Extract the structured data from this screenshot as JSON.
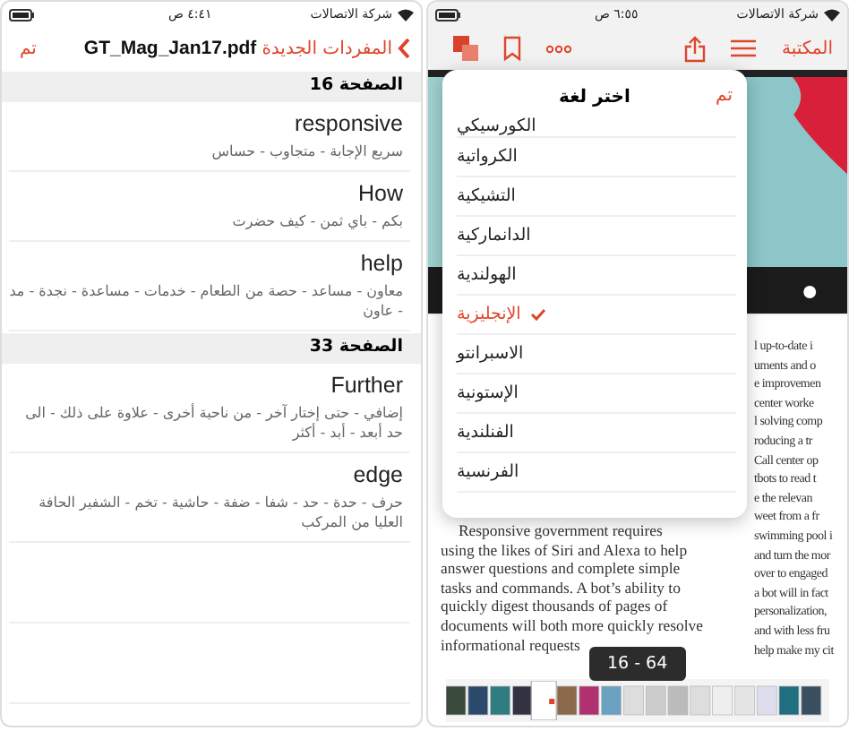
{
  "left_screen": {
    "status_bar": {
      "carrier": "شركة الاتصالات",
      "time": "٤:٤١ ص"
    },
    "nav_bar": {
      "back_label": "المفردات الجديدة",
      "title": "GT_Mag_Jan17.pdf",
      "done_label": "تم"
    },
    "sections": [
      {
        "header": "الصفحة 16",
        "entries": [
          {
            "word": "responsive",
            "translation": "سريع الإجابة - متجاوب - حساس"
          },
          {
            "word": "How",
            "translation": "بكم - باي ثمن - كيف حضرت"
          },
          {
            "word": "help",
            "translation": "معاون - مساعد - حصة من الطعام - خدمات - مساعدة - نجدة - مد - عاون"
          }
        ]
      },
      {
        "header": "الصفحة 33",
        "entries": [
          {
            "word": "Further",
            "translation": "إضافي - حتى إختار آخر - من ناحية أخرى - علاوة على ذلك - الى حد أبعد - أبد - أكثر"
          },
          {
            "word": "edge",
            "translation": "حرف - حدة - حد - شفا - ضفة - حاشية - تخم - الشفير الحافة العليا من المركب"
          }
        ]
      }
    ]
  },
  "right_screen": {
    "status_bar": {
      "carrier": "شركة الاتصالات",
      "time": "٦:٥٥ ص"
    },
    "toolbar": {
      "library_label": "المكتبة"
    },
    "language_picker": {
      "title": "اختر لغة",
      "done_label": "تم",
      "languages": [
        {
          "name": "الكورسيكي",
          "selected": false
        },
        {
          "name": "الكرواتية",
          "selected": false
        },
        {
          "name": "التشيكية",
          "selected": false
        },
        {
          "name": "الدانماركية",
          "selected": false
        },
        {
          "name": "الهولندية",
          "selected": false
        },
        {
          "name": "الإنجليزية",
          "selected": true
        },
        {
          "name": "الاسبرانتو",
          "selected": false
        },
        {
          "name": "الإستونية",
          "selected": false
        },
        {
          "name": "الفنلندية",
          "selected": false
        },
        {
          "name": "الفرنسية",
          "selected": false
        }
      ]
    },
    "article": {
      "column_1": [
        "Responsive government requires",
        "using the likes of Siri and Alexa to help",
        "answer questions and complete simple",
        "tasks and commands. A bot’s ability to",
        "quickly digest thousands of pages of",
        "documents will both more quickly resolve",
        "informational requests"
      ],
      "column_2": [
        "l up-to-date i",
        "uments and o",
        "e improvemen",
        "center worke",
        "l solving comp",
        "roducing a tr",
        "Call center op",
        "tbots to read t",
        "e the relevan",
        "weet from a fr",
        "swimming pool i",
        "and turn the mor",
        "over to engaged",
        "a bot will in fact",
        "personalization,",
        "and with less fru",
        "help make my cit"
      ]
    },
    "page_indicator": "16 - 64"
  }
}
